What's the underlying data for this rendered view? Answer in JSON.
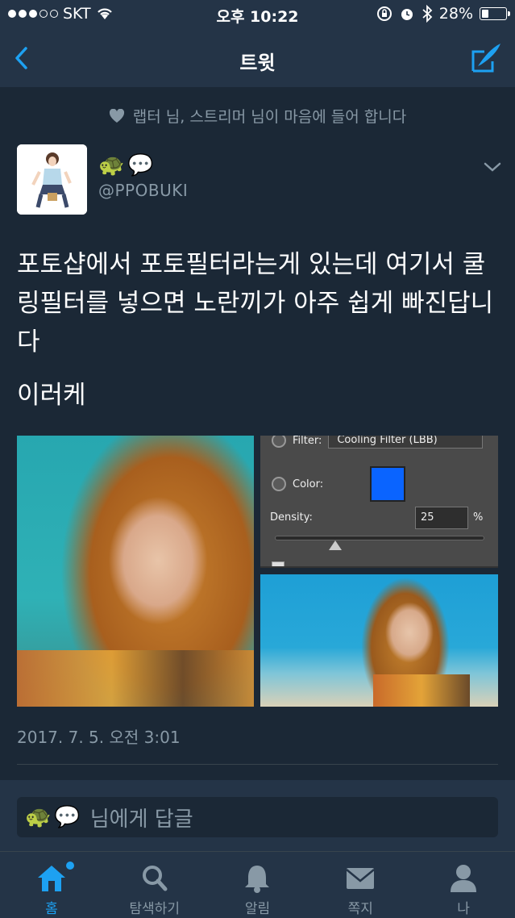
{
  "status_bar": {
    "carrier": "SKT",
    "time": "오후 10:22",
    "battery_percent": "28%",
    "battery_level": 0.28,
    "signal_dots_filled": 3,
    "signal_dots_total": 5
  },
  "nav": {
    "title": "트윗",
    "back_icon": "chevron-left-icon",
    "compose_icon": "compose-quill-icon"
  },
  "social_context": {
    "icon": "heart-icon",
    "text": "랩터 님, 스트리머 님이 마음에 들어 합니다"
  },
  "tweet": {
    "display_name_emoji": [
      "🐢",
      "💬"
    ],
    "handle": "@PPOBUKI",
    "paragraphs": [
      "포토샵에서 포토필터라는게 있는데 여기서 쿨링필터를 넣으면 노란끼가 아주 쉽게 빠진답니다",
      "이러케"
    ],
    "timestamp": "2017. 7. 5. 오전 3:01"
  },
  "media_panel": {
    "filter_label": "Filter:",
    "filter_value": "Cooling Filter (LBB)",
    "color_label": "Color:",
    "color_swatch": "#0a64ff",
    "density_label": "Density:",
    "density_value": "25",
    "density_unit": "%",
    "density_level": 0.25
  },
  "reply": {
    "emoji": [
      "🐢",
      "💬"
    ],
    "placeholder": "님에게 답글"
  },
  "tabs": [
    {
      "label": "홈",
      "icon": "home-icon",
      "active": true
    },
    {
      "label": "탐색하기",
      "icon": "search-icon",
      "active": false
    },
    {
      "label": "알림",
      "icon": "bell-icon",
      "active": false
    },
    {
      "label": "쪽지",
      "icon": "mail-icon",
      "active": false
    },
    {
      "label": "나",
      "icon": "person-icon",
      "active": false
    }
  ],
  "colors": {
    "accent": "#1da1f2",
    "background": "#1b2836",
    "bar": "#243447",
    "muted_text": "#8899a6"
  }
}
